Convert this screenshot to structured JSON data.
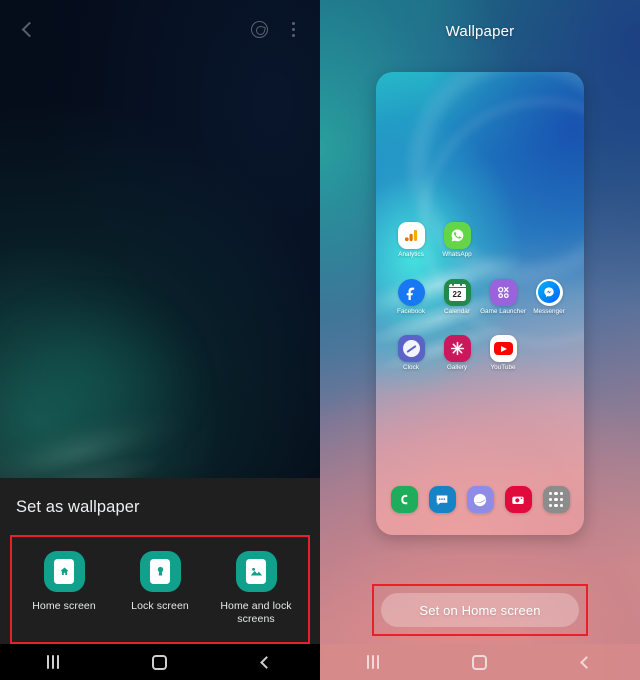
{
  "left_panel": {
    "name": "wallpaper-preview-screen",
    "topbar": {
      "back_icon": "chevron-left-icon",
      "palette_icon": "color-palette-icon",
      "overflow_icon": "more-options-icon"
    },
    "sheet": {
      "title": "Set as wallpaper",
      "options": [
        {
          "label": "Home screen",
          "icon": "home-screen-icon"
        },
        {
          "label": "Lock screen",
          "icon": "lock-screen-icon"
        },
        {
          "label": "Home and lock screens",
          "icon": "home-and-lock-screens-icon"
        }
      ]
    },
    "navbar": {
      "recents": "recents-icon",
      "home": "home-icon",
      "back": "back-icon"
    },
    "accent_teal": "#10a08c",
    "highlight_red": "#e8202a"
  },
  "right_panel": {
    "name": "wallpaper-apply-screen",
    "title": "Wallpaper",
    "preview": {
      "app_rows": [
        [
          {
            "label": "Analytics",
            "icon": "google-analytics-icon"
          },
          {
            "label": "WhatsApp",
            "icon": "whatsapp-icon"
          }
        ],
        [
          {
            "label": "Facebook",
            "icon": "facebook-icon"
          },
          {
            "label": "Calendar",
            "icon": "calendar-icon",
            "day": "22"
          },
          {
            "label": "Game Launcher",
            "icon": "game-launcher-icon"
          },
          {
            "label": "Messenger",
            "icon": "messenger-icon"
          }
        ],
        [
          {
            "label": "Clock",
            "icon": "clock-icon"
          },
          {
            "label": "Gallery",
            "icon": "gallery-icon"
          },
          {
            "label": "YouTube",
            "icon": "youtube-icon"
          }
        ]
      ],
      "dock": [
        {
          "label": "Phone",
          "icon": "phone-icon"
        },
        {
          "label": "Messages",
          "icon": "messages-icon"
        },
        {
          "label": "Internet",
          "icon": "internet-icon"
        },
        {
          "label": "Camera",
          "icon": "camera-icon"
        },
        {
          "label": "Apps",
          "icon": "apps-drawer-icon"
        }
      ]
    },
    "set_button_label": "Set on Home screen",
    "navbar": {
      "recents": "recents-icon",
      "home": "home-icon",
      "back": "back-icon"
    },
    "highlight_red": "#e8202a"
  }
}
